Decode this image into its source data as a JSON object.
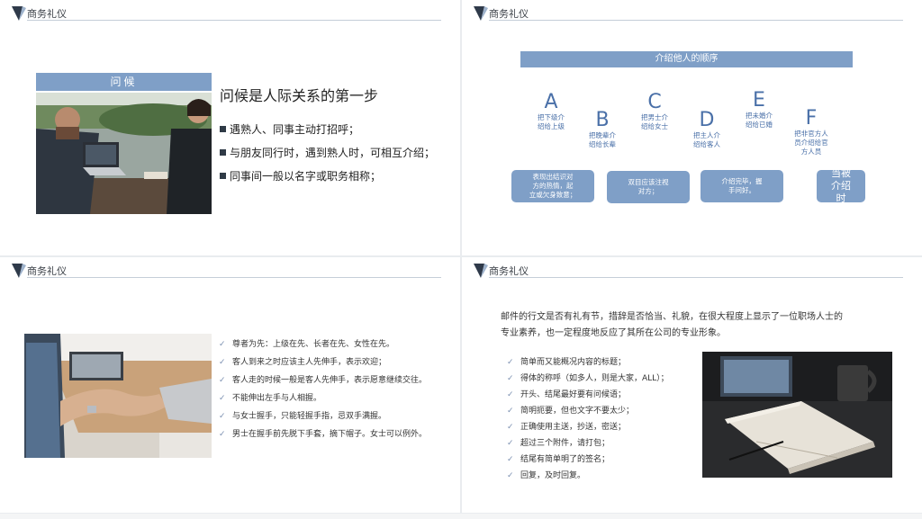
{
  "header_title": "商务礼仪",
  "slide1": {
    "label": "问候",
    "heading": "问候是人际关系的第一步",
    "bullets": [
      "遇熟人、同事主动打招呼；",
      "与朋友同行时，遇到熟人时，可相互介绍；",
      "同事间一般以名字或职务相称；"
    ]
  },
  "slide2": {
    "bar_title": "介绍他人的顺序",
    "steps": [
      {
        "letter": "A",
        "line1": "把下级介",
        "line2": "绍给上级",
        "line3": ""
      },
      {
        "letter": "B",
        "line1": "把晚辈介",
        "line2": "绍给长辈",
        "line3": ""
      },
      {
        "letter": "C",
        "line1": "把男士介",
        "line2": "绍给女士",
        "line3": ""
      },
      {
        "letter": "D",
        "line1": "把主人介",
        "line2": "绍给客人",
        "line3": ""
      },
      {
        "letter": "E",
        "line1": "把未婚介",
        "line2": "绍给已婚",
        "line3": ""
      },
      {
        "letter": "F",
        "line1": "把非官方人",
        "line2": "员介绍给官",
        "line3": "方人员"
      }
    ],
    "notes": [
      {
        "line1": "表现出结识对",
        "line2": "方的热情，起",
        "line3": "立或欠身致意；"
      },
      {
        "line1": "双目应该注视",
        "line2": "对方；",
        "line3": ""
      },
      {
        "line1": "介绍完毕，握",
        "line2": "手问好。",
        "line3": ""
      },
      {
        "line1": "当被",
        "line2": "介绍时",
        "line3": ""
      }
    ]
  },
  "slide3": {
    "items": [
      "尊者为先：上级在先、长者在先、女性在先。",
      "客人到来之时应该主人先伸手，表示欢迎；",
      "客人走的时候一般是客人先伸手，表示愿意继续交往。",
      "不能伸出左手与人相握。",
      "与女士握手，只能轻握手指，忌双手满握。",
      "男士在握手前先脱下手套，摘下帽子。女士可以例外。"
    ]
  },
  "slide4": {
    "para_line1": "邮件的行文是否有礼有节，措辞是否恰当、礼貌，在很大程度上显示了一位职场人士的",
    "para_line2": "专业素养，也一定程度地反应了其所在公司的专业形象。",
    "items": [
      "简单而又能概况内容的标题；",
      "得体的称呼（如多人，则是大家，ALL）；",
      "开头、结尾最好要有问候语；",
      "简明扼要，但也文字不要太少；",
      "正确使用主送，抄送，密送；",
      "超过三个附件，请打包；",
      "结尾有简单明了的签名；",
      "回复，及时回复。"
    ]
  },
  "icons": {
    "logo": "triangle-logo-icon",
    "check": "checkmark-icon",
    "bullet": "square-bullet-icon"
  },
  "colors": {
    "accent": "#7f9fc7",
    "letter": "#4a70a8",
    "logo_dark": "#2f3a4a"
  }
}
